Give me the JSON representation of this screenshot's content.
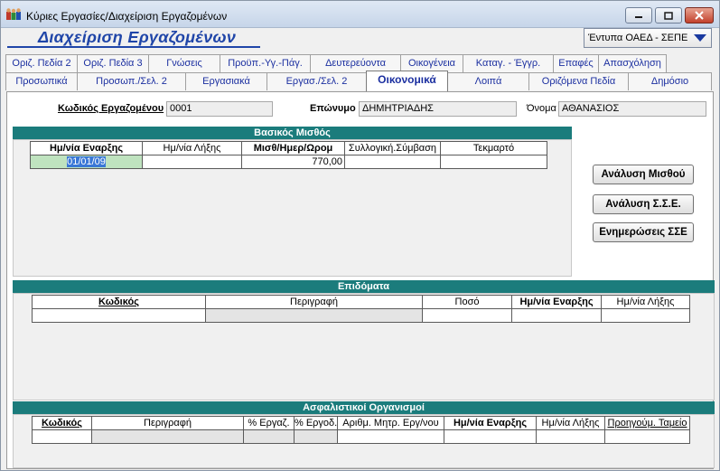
{
  "window": {
    "title": "Κύριες Εργασίες/Διαχείριση Εργαζομένων"
  },
  "header": {
    "title": "Διαχείριση Εργαζομένων",
    "forms_dropdown": "Έντυπα ΟΑΕΔ - ΣΕΠΕ"
  },
  "tabs_row1": [
    "Οριζ. Πεδία 2",
    "Οριζ. Πεδία 3",
    "Γνώσεις",
    "Προϋπ.-Υγ.-Πάγ.",
    "Δευτερεύοντα",
    "Οικογένεια",
    "Καταγ. - Έγγρ.",
    "Επαφές",
    "Απασχόληση"
  ],
  "tabs_row2": [
    "Προσωπικά",
    "Προσωπ./Σελ. 2",
    "Εργασιακά",
    "Εργασ./Σελ. 2",
    "Οικονομικά",
    "Λοιπά",
    "Οριζόμενα Πεδία",
    "Δημόσιο"
  ],
  "active_tab": "Οικονομικά",
  "employee": {
    "code_label": "Κωδικός Εργαζομένου",
    "code_value": "0001",
    "surname_label": "Επώνυμο",
    "surname_value": "ΔΗΜΗΤΡΙΑΔΗΣ",
    "name_label": "Όνομα",
    "name_value": "ΑΘΑΝΑΣΙΟΣ"
  },
  "basic_salary": {
    "title": "Βασικός Μισθός",
    "columns": [
      "Ημ/νία Εναρξης",
      "Ημ/νία Λήξης",
      "Μισθ/Ημερ/Ωρομ",
      "Συλλογική.Σύμβαση",
      "Τεκμαρτό"
    ],
    "row": {
      "start_date": "01/01/09",
      "end_date": "",
      "amount": "770,00",
      "agreement": "",
      "imputed": ""
    }
  },
  "buttons": {
    "salary_analysis": "Ανάλυση Μισθού",
    "sse_analysis": "Ανάλυση Σ.Σ.Ε.",
    "sse_updates": "Ενημερώσεις ΣΣΕ"
  },
  "allowances": {
    "title": "Επιδόματα",
    "columns": [
      "Κωδικός",
      "Περιγραφή",
      "Ποσό",
      "Ημ/νία Εναρξης",
      "Ημ/νία Λήξης"
    ]
  },
  "insurance": {
    "title": "Ασφαλιστικοί Οργανισμοί",
    "columns": [
      "Κωδικός",
      "Περιγραφή",
      "% Εργαζ.",
      "% Εργοδ.",
      "Αριθμ. Μητρ. Εργ/νου",
      "Ημ/νία Εναρξης",
      "Ημ/νία Λήξης",
      "Προηγούμ. Ταμείο"
    ]
  },
  "colors": {
    "section_bar": "#1b7c7c",
    "title_blue": "#1f45a8",
    "tab_text": "#1b2fa0",
    "date_cell": "#bfe3bf"
  }
}
